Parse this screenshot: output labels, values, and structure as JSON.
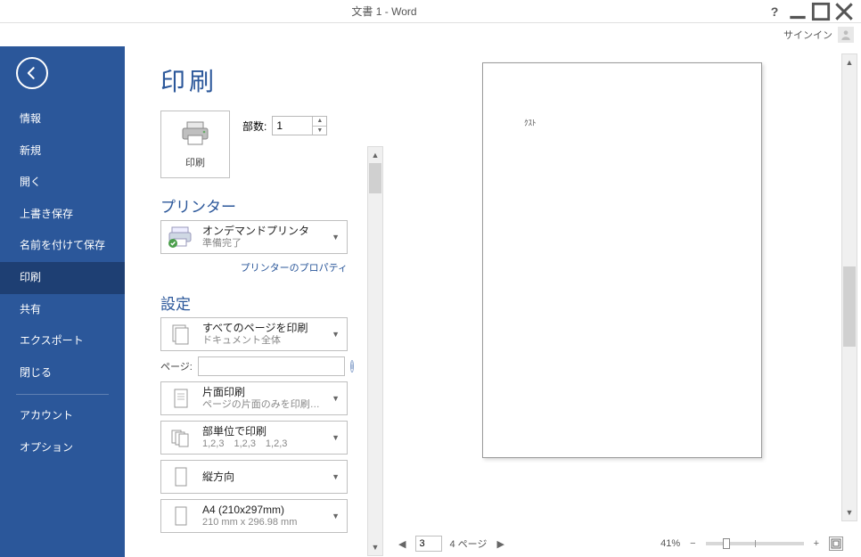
{
  "window": {
    "title": "文書 1 - Word",
    "signin": "サインイン"
  },
  "sidebar": {
    "items": [
      "情報",
      "新規",
      "開く",
      "上書き保存",
      "名前を付けて保存",
      "印刷",
      "共有",
      "エクスポート",
      "閉じる"
    ],
    "footer": [
      "アカウント",
      "オプション"
    ],
    "active_index": 5
  },
  "page": {
    "title": "印刷"
  },
  "print": {
    "button_label": "印刷",
    "copies_label": "部数:",
    "copies_value": "1"
  },
  "printer": {
    "section_title": "プリンター",
    "name": "オンデマンドプリンタ",
    "status": "準備完了",
    "properties_link": "プリンターのプロパティ"
  },
  "settings": {
    "section_title": "設定",
    "pages_label": "ページ:",
    "pages_value": "",
    "opts": [
      {
        "t1": "すべてのページを印刷",
        "t2": "ドキュメント全体"
      },
      {
        "t1": "片面印刷",
        "t2": "ページの片面のみを印刷…"
      },
      {
        "t1": "部単位で印刷",
        "t2": "1,2,3　1,2,3　1,2,3"
      },
      {
        "t1": "縦方向",
        "t2": ""
      },
      {
        "t1": "A4 (210x297mm)",
        "t2": "210 mm x 296.98 mm"
      }
    ]
  },
  "preview": {
    "sample_text": "ｸｽﾄ",
    "current_page": "3",
    "total_label": "4 ページ",
    "zoom": "41%"
  }
}
